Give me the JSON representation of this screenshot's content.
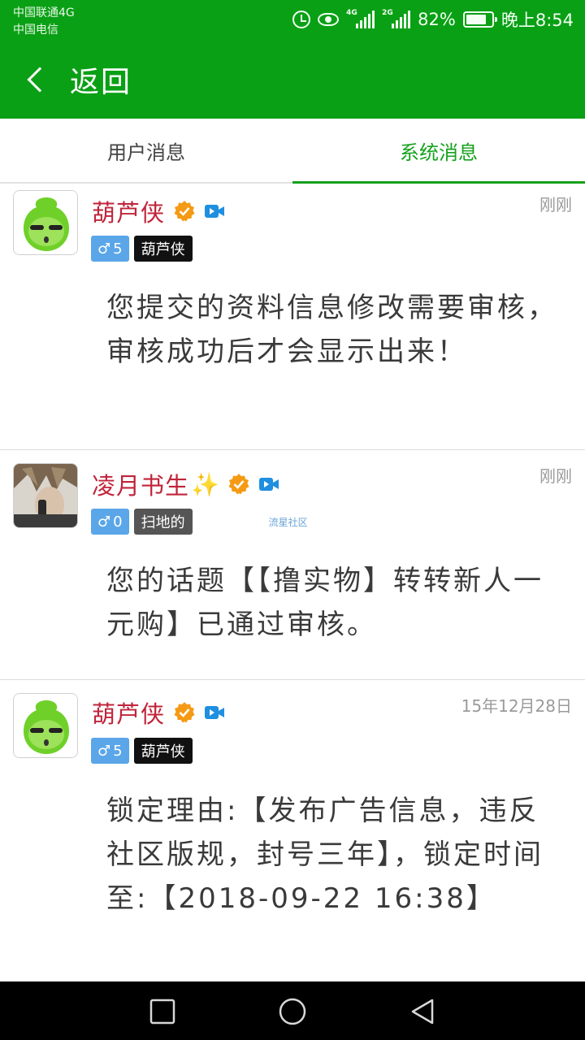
{
  "status_bar": {
    "carrier_1": "中国联通4G",
    "carrier_2": "中国电信",
    "signal_1_tag": "4G",
    "signal_2_tag": "2G",
    "battery": "82%",
    "time": "晚上8:54"
  },
  "header": {
    "back_label": "返回",
    "icon": "chevron-left-icon"
  },
  "tabs": [
    {
      "label": "用户消息",
      "active": false
    },
    {
      "label": "系统消息",
      "active": true
    }
  ],
  "messages": [
    {
      "sender": "葫芦侠",
      "gender_symbol": "♂",
      "level": "5",
      "role": "葫芦侠",
      "time": "刚刚",
      "content": "您提交的资料信息修改需要审核，审核成功后才会显示出来！"
    },
    {
      "sender": "凌月书生",
      "sender_emoji": "✨",
      "gender_symbol": "♂",
      "level": "0",
      "role": "扫地的",
      "watermark": "流星社区",
      "time": "刚刚",
      "content": "您的话题【【撸实物】转转新人一元购】已通过审核。"
    },
    {
      "sender": "葫芦侠",
      "gender_symbol": "♂",
      "level": "5",
      "role": "葫芦侠",
      "time": "15年12月28日",
      "content": "锁定理由:【发布广告信息，违反社区版规，封号三年】，锁定时间至:【2018-09-22 16:38】"
    }
  ],
  "colors": {
    "brand_green": "#0aa015",
    "tab_active": "#15a11d",
    "username_red": "#c0243a",
    "level_blue": "#5aa6e8"
  }
}
